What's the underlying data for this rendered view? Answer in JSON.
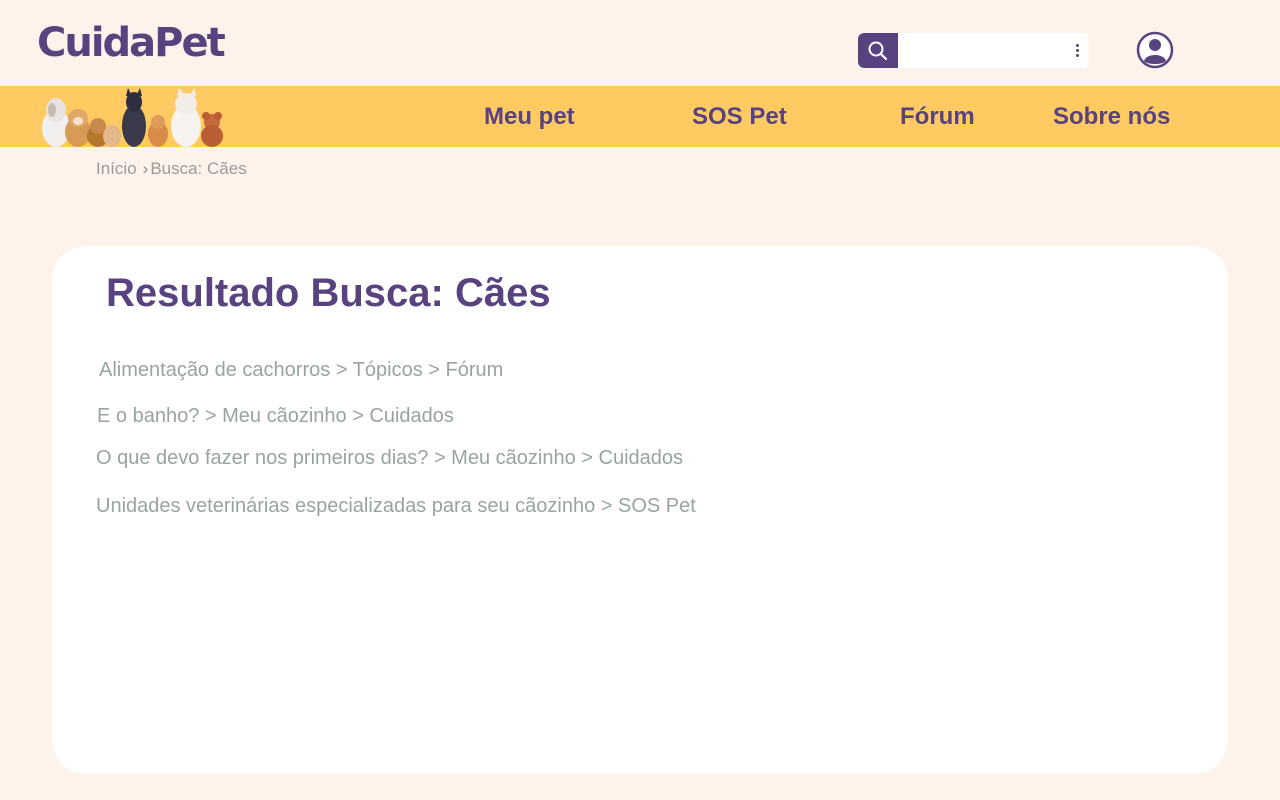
{
  "header": {
    "logo": "CuidaPet",
    "search": {
      "value": "",
      "placeholder": ""
    }
  },
  "nav": {
    "items": [
      {
        "label": "Meu pet"
      },
      {
        "label": "SOS Pet"
      },
      {
        "label": "Fórum"
      },
      {
        "label": "Sobre nós"
      }
    ]
  },
  "breadcrumb": {
    "home": "Início",
    "separator": "›",
    "current": "Busca: Cães"
  },
  "main": {
    "title": "Resultado Busca: Cães",
    "results": [
      {
        "text": "Alimentação de cachorros > Tópicos > Fórum"
      },
      {
        "text": "E o banho? > Meu cãozinho > Cuidados"
      },
      {
        "text": "O que devo fazer nos primeiros dias? > Meu cãozinho > Cuidados"
      },
      {
        "text": "Unidades veterinárias especializadas para seu cãozinho > SOS Pet"
      }
    ]
  },
  "colors": {
    "brand": "#58427f",
    "nav_background": "#ffca62",
    "page_background": "#fef3ea",
    "card_background": "#ffffff",
    "result_text": "#98a4a0"
  },
  "icons": [
    "search-icon",
    "more-vertical-icon",
    "user-profile-icon"
  ]
}
